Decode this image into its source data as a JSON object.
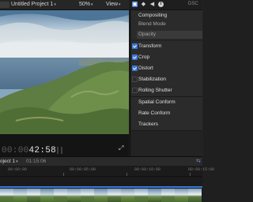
{
  "viewer": {
    "project_title": "Untitled Project 1",
    "zoom": "50%",
    "view_label": "View",
    "timecode_dim": "00:00",
    "timecode": "42:58"
  },
  "inspector": {
    "header_text": "DSC",
    "sections": {
      "compositing": "Compositing",
      "blend_mode": "Blend Mode",
      "opacity": "Opacity",
      "transform": "Transform",
      "crop": "Crop",
      "distort": "Distort",
      "stabilization": "Stabilization",
      "rolling_shutter": "Rolling Shutter",
      "spatial_conform": "Spatial Conform",
      "rate_conform": "Rate Conform",
      "trackers": "Trackers"
    },
    "checked": {
      "transform": true,
      "crop": true,
      "distort": true,
      "stabilization": false,
      "rolling_shutter": false
    }
  },
  "timeline": {
    "project_label": "oject 1",
    "duration": "01:15:06",
    "ruler_ticks": [
      "00:00:00",
      "00:00:05:00",
      "00:00:10:00",
      "00:00:15:00"
    ],
    "accent": "#3b78d8"
  },
  "icons": [
    "video-inspector-icon",
    "color-inspector-icon",
    "audio-inspector-icon",
    "info-inspector-icon",
    "fullscreen-icon",
    "chevron-down-icon"
  ]
}
